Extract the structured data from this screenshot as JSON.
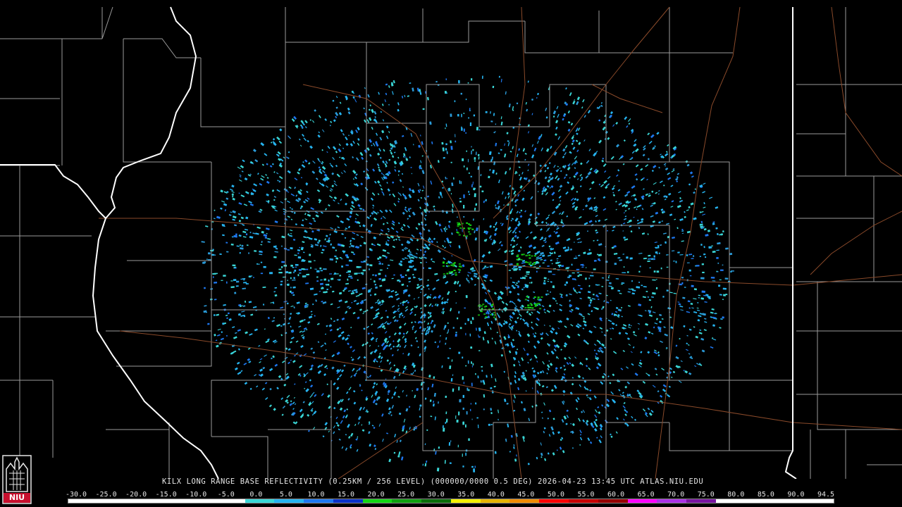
{
  "caption": "KILX LONG RANGE BASE REFLECTIVITY (0.25KM / 256 LEVEL) (000000/0000 0.5 DEG) 2026-04-23 13:45 UTC  ATLAS.NIU.EDU",
  "logo_text": "NIU",
  "colorbar": {
    "ticks": [
      "-30.0",
      "-25.0",
      "-20.0",
      "-15.0",
      "-10.0",
      "-5.0",
      "0.0",
      "5.0",
      "10.0",
      "15.0",
      "20.0",
      "25.0",
      "30.0",
      "35.0",
      "40.0",
      "45.0",
      "50.0",
      "55.0",
      "60.0",
      "65.0",
      "70.0",
      "75.0",
      "80.0",
      "85.0",
      "90.0",
      "94.5"
    ],
    "colors": [
      "#ffffff",
      "#ffffff",
      "#ffffff",
      "#ffffff",
      "#ffffff",
      "#ffffff",
      "#3ad6d6",
      "#26b4f0",
      "#1e78f0",
      "#0a32c8",
      "#14d614",
      "#10a010",
      "#0a6e0a",
      "#f5f000",
      "#e6b400",
      "#f08c00",
      "#ff0000",
      "#c80000",
      "#960000",
      "#ff00ff",
      "#aa32e6",
      "#7814a0",
      "#ffffff",
      "#ffffff",
      "#ffffff",
      "#ffffff"
    ]
  },
  "colors": {
    "background": "#000000",
    "county_lines": "#9a9a9a",
    "state_lines": "#ffffff",
    "roads": "#8a4a2a"
  }
}
